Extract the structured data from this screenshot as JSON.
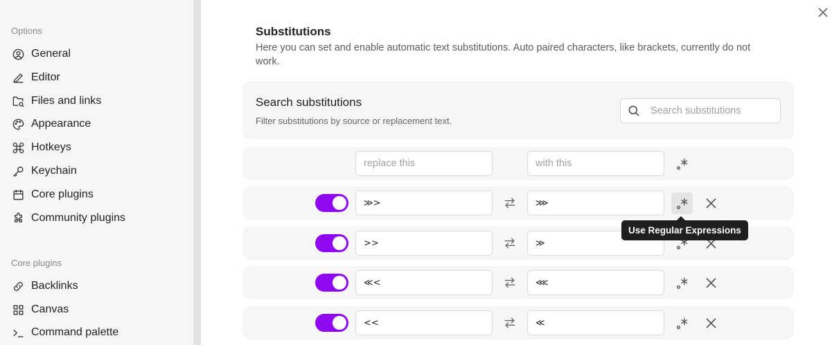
{
  "sidebar": {
    "options_title": "Options",
    "options": [
      {
        "label": "General",
        "icon": "user-circle-icon"
      },
      {
        "label": "Editor",
        "icon": "pencil-icon"
      },
      {
        "label": "Files and links",
        "icon": "folder-link-icon"
      },
      {
        "label": "Appearance",
        "icon": "palette-icon"
      },
      {
        "label": "Hotkeys",
        "icon": "command-icon"
      },
      {
        "label": "Keychain",
        "icon": "key-icon"
      },
      {
        "label": "Core plugins",
        "icon": "calendar-icon"
      },
      {
        "label": "Community plugins",
        "icon": "puzzle-icon"
      }
    ],
    "core_title": "Core plugins",
    "core": [
      {
        "label": "Backlinks",
        "icon": "link-icon"
      },
      {
        "label": "Canvas",
        "icon": "layout-grid-icon"
      },
      {
        "label": "Command palette",
        "icon": "terminal-icon"
      }
    ]
  },
  "main": {
    "heading": "Substitutions",
    "description": "Here you can set and enable automatic text substitutions. Auto paired characters, like brackets, currently do not work.",
    "search": {
      "title": "Search substitutions",
      "subtitle": "Filter substitutions by source or replacement text.",
      "placeholder": "Search substitutions"
    },
    "new_row": {
      "source_placeholder": "replace this",
      "target_placeholder": "with this"
    },
    "rules": [
      {
        "source": "≫>",
        "target": "⋙",
        "enabled": true
      },
      {
        "source": ">>",
        "target": "≫",
        "enabled": true
      },
      {
        "source": "≪<",
        "target": "⋘",
        "enabled": true
      },
      {
        "source": "<<",
        "target": "≪",
        "enabled": true
      }
    ],
    "tooltip": "Use Regular Expressions"
  },
  "colors": {
    "accent": "#8e08f0",
    "sidebar_bg": "#f6f6f6",
    "card_bg": "#f6f6f6"
  }
}
